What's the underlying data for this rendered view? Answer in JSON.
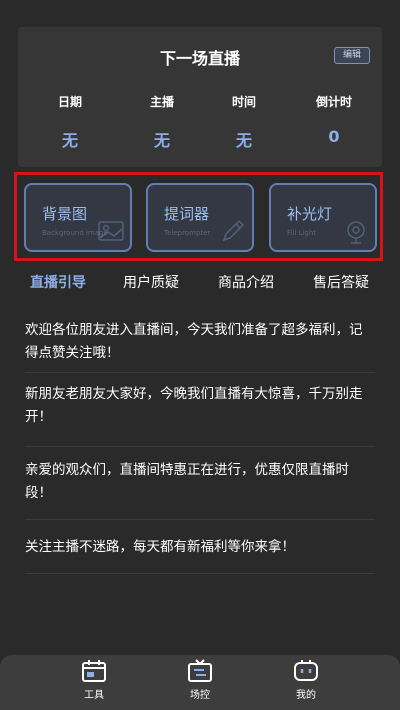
{
  "next_live": {
    "title": "下一场直播",
    "edit_label": "编辑",
    "fields": [
      {
        "label": "日期",
        "value": "无"
      },
      {
        "label": "主播",
        "value": "无"
      },
      {
        "label": "时间",
        "value": "无"
      },
      {
        "label": "倒计时",
        "value": "0"
      }
    ]
  },
  "tools": [
    {
      "name": "背景图",
      "sub": "Background image",
      "icon": "image-icon"
    },
    {
      "name": "提词器",
      "sub": "Teleprompter",
      "icon": "pen-icon"
    },
    {
      "name": "补光灯",
      "sub": "Fill Light",
      "icon": "lamp-icon"
    }
  ],
  "tabs": [
    {
      "label": "直播引导",
      "active": true
    },
    {
      "label": "用户质疑",
      "active": false
    },
    {
      "label": "商品介绍",
      "active": false
    },
    {
      "label": "售后答疑",
      "active": false
    }
  ],
  "scripts": [
    "欢迎各位朋友进入直播间，今天我们准备了超多福利，记得点赞关注哦！",
    "新朋友老朋友大家好，今晚我们直播有大惊喜，千万别走开！",
    "亲爱的观众们，直播间特惠正在进行，优惠仅限直播时段！",
    "关注主播不迷路，每天都有新福利等你来拿！"
  ],
  "bottom_nav": [
    {
      "label": "工具",
      "icon": "calendar-icon"
    },
    {
      "label": "场控",
      "icon": "tv-control-icon"
    },
    {
      "label": "我的",
      "icon": "robot-face-icon"
    }
  ],
  "colors": {
    "accent": "#8aaee6",
    "highlight_border": "#d6121b",
    "background": "#2a2a2a",
    "card": "#363636"
  }
}
